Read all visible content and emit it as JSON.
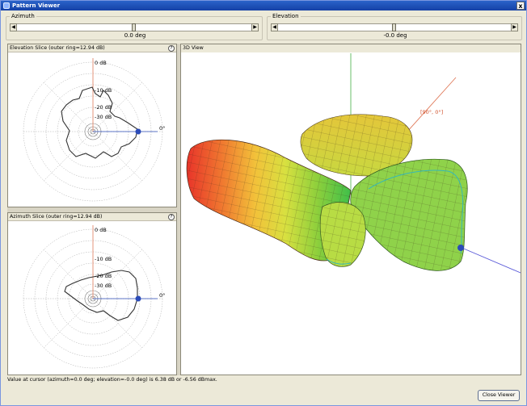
{
  "window": {
    "title": "Pattern Viewer",
    "close_glyph": "x"
  },
  "azimuth": {
    "label": "Azimuth",
    "value": "0.0 deg",
    "position": 0.5
  },
  "elevation": {
    "label": "Elevation",
    "value": "-0.0 deg",
    "position": 0.5
  },
  "elevation_slice": {
    "title": "Elevation Slice (outer ring=12.94 dB)",
    "ring_labels": [
      "0 dB",
      "-10 dB",
      "-20 dB",
      "-30 dB"
    ],
    "angle_label": "0°"
  },
  "azimuth_slice": {
    "title": "Azimuth Slice (outer ring=12.94 dB)",
    "ring_labels": [
      "0 dB",
      "-10 dB",
      "-20 dB",
      "-30 dB"
    ],
    "angle_label": "0°"
  },
  "view3d": {
    "title": "3D View",
    "cursor_label": "[90°, 0°]"
  },
  "help_glyph": "?",
  "status_text": "Value at cursor (azimuth=0.0 deg; elevation=-0.0 deg) is 6.38 dB or -6.56 dBmax.",
  "close_button": "Close Viewer",
  "colors": {
    "title_bar": "#1d4fb5",
    "cursor_dot": "#2b4bb8",
    "axis_x": "#5a5ad8",
    "axis_y": "#58b858",
    "axis_z": "#e07a5a"
  }
}
